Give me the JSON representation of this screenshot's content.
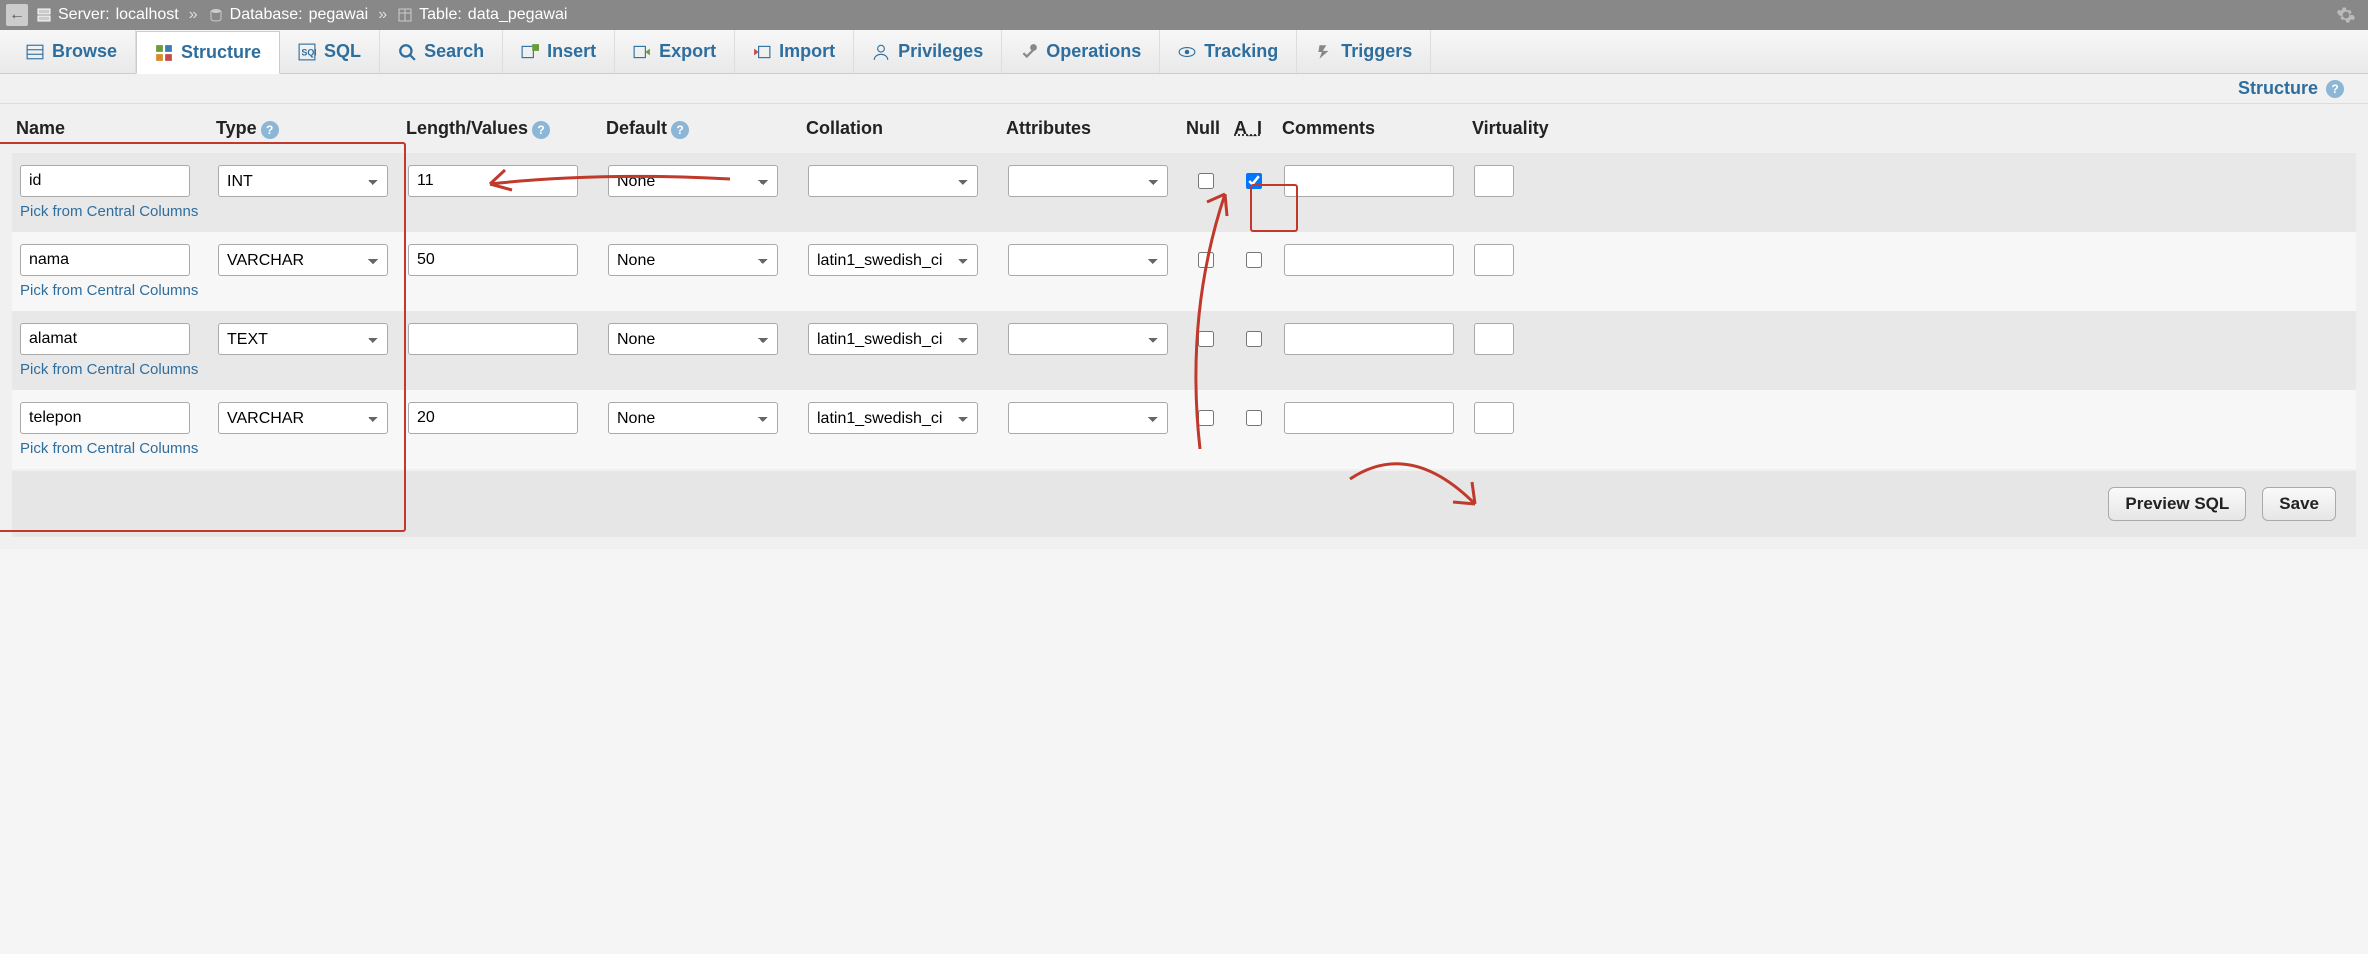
{
  "breadcrumb": {
    "server_label": "Server: ",
    "server_value": "localhost",
    "database_label": "Database: ",
    "database_value": "pegawai",
    "table_label": "Table: ",
    "table_value": "data_pegawai"
  },
  "tabs": {
    "browse": "Browse",
    "structure": "Structure",
    "sql": "SQL",
    "search": "Search",
    "insert": "Insert",
    "export": "Export",
    "import": "Import",
    "privileges": "Privileges",
    "operations": "Operations",
    "tracking": "Tracking",
    "triggers": "Triggers"
  },
  "sub_header": "Structure",
  "headers": {
    "name": "Name",
    "type": "Type",
    "length": "Length/Values",
    "default": "Default",
    "collation": "Collation",
    "attributes": "Attributes",
    "null": "Null",
    "ai": "A_I",
    "comments": "Comments",
    "virtuality": "Virtuality"
  },
  "pick_link": "Pick from Central Columns",
  "rows": [
    {
      "name": "id",
      "type": "INT",
      "length": "11",
      "default": "None",
      "collation": "",
      "attributes": "",
      "null": false,
      "ai": true,
      "comments": ""
    },
    {
      "name": "nama",
      "type": "VARCHAR",
      "length": "50",
      "default": "None",
      "collation": "latin1_swedish_ci",
      "attributes": "",
      "null": false,
      "ai": false,
      "comments": ""
    },
    {
      "name": "alamat",
      "type": "TEXT",
      "length": "",
      "default": "None",
      "collation": "latin1_swedish_ci",
      "attributes": "",
      "null": false,
      "ai": false,
      "comments": ""
    },
    {
      "name": "telepon",
      "type": "VARCHAR",
      "length": "20",
      "default": "None",
      "collation": "latin1_swedish_ci",
      "attributes": "",
      "null": false,
      "ai": false,
      "comments": ""
    }
  ],
  "buttons": {
    "preview": "Preview SQL",
    "save": "Save"
  }
}
